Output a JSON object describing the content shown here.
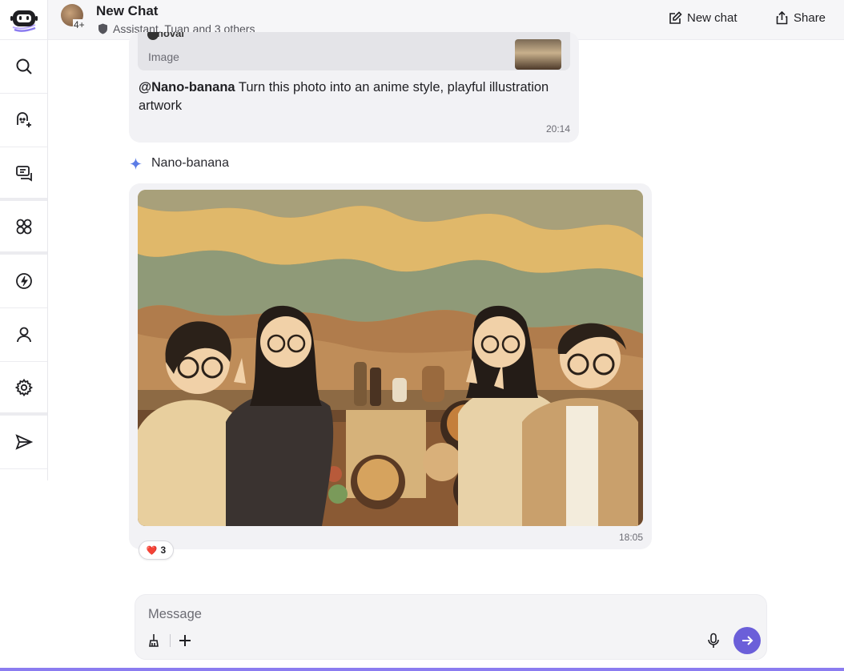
{
  "sidebar": {
    "items": [
      {
        "name": "search",
        "icon": "search-icon"
      },
      {
        "name": "new-bot",
        "icon": "bot-add-icon"
      },
      {
        "name": "chats",
        "icon": "chat-icon"
      },
      {
        "name": "explore",
        "icon": "apps-icon"
      },
      {
        "name": "subscription",
        "icon": "bolt-icon"
      },
      {
        "name": "profile",
        "icon": "user-icon"
      },
      {
        "name": "settings",
        "icon": "gear-icon"
      },
      {
        "name": "send-feedback",
        "icon": "send-icon"
      }
    ]
  },
  "header": {
    "title": "New Chat",
    "participant_count": "4+",
    "participants": "Assistant, Tuan and 3 others",
    "new_chat_label": "New chat",
    "share_label": "Share"
  },
  "messages": {
    "user": {
      "quote_author": "novai",
      "quote_label": "Image",
      "mention": "@Nano-banana",
      "text": " Turn this photo into an anime style, playful illustration artwork",
      "time": "20:14"
    },
    "bot": {
      "name": "Nano-banana",
      "time": "18:05",
      "reaction_emoji": "❤️",
      "reaction_count": "3"
    }
  },
  "composer": {
    "placeholder": "Message"
  },
  "colors": {
    "accent": "#6b5fd9",
    "bubble": "#f2f2f5",
    "header_bg": "#f6f6f8"
  }
}
